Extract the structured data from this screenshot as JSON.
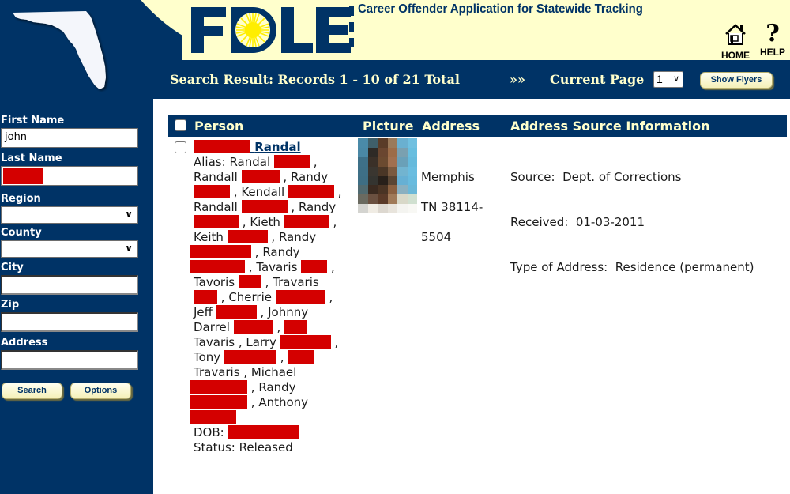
{
  "header": {
    "logo_text": "FDLE",
    "app_title": "Career Offender Application for Statewide Tracking",
    "nav": [
      {
        "icon": "home-icon",
        "label": "HOME"
      },
      {
        "icon": "help-icon",
        "label": "HELP"
      }
    ]
  },
  "results_bar": {
    "summary": "Search Result: Records 1 - 10 of 21 Total",
    "next_arrows": "»»",
    "current_page_label": "Current Page",
    "current_page_value": "1",
    "show_flyers_label": "Show Flyers"
  },
  "sidebar": {
    "fields": {
      "first_name": {
        "label": "First Name",
        "value": "john"
      },
      "last_name": {
        "label": "Last Name",
        "value": "[redacted]"
      },
      "region": {
        "label": "Region",
        "value": ""
      },
      "county": {
        "label": "County",
        "value": ""
      },
      "city": {
        "label": "City",
        "value": ""
      },
      "zip": {
        "label": "Zip",
        "value": ""
      },
      "address": {
        "label": "Address",
        "value": ""
      }
    },
    "search_label": "Search",
    "options_label": "Options"
  },
  "table": {
    "columns": [
      "Person",
      "Picture",
      "Address",
      "Address Source Information"
    ],
    "rows": [
      {
        "person": {
          "name_visible": "Randal",
          "alias_prefix": "Alias:",
          "alias_names": [
            "Randal",
            "Randall",
            "Randy",
            "Kendall",
            "Randall",
            "Randy",
            "Kieth",
            "Keith",
            "Randy",
            "Randy",
            "Tavaris",
            "Tavoris",
            "Travaris",
            "Cherrie",
            "Jeff",
            "Johnny",
            "Darrel",
            "Tavaris",
            "Larry",
            "Tony",
            "Travaris",
            "Michael",
            "Randy",
            "Anthony"
          ],
          "dob_label": "DOB:",
          "status": "Status: Released"
        },
        "address": {
          "city": "Memphis",
          "state_zip": "TN 38114-",
          "zip_ext": "5504"
        },
        "source": {
          "source": "Source:  Dept. of Corrections",
          "received": "Received:  01-03-2011",
          "type": "Type of Address:  Residence (permanent)"
        }
      }
    ]
  },
  "colors": {
    "navy": "#003366",
    "cream": "#ffffcc",
    "redaction": "#d40000",
    "sun": "#ffee00"
  }
}
